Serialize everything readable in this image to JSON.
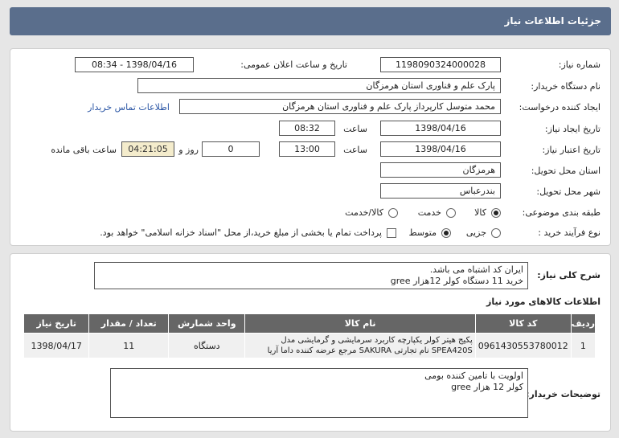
{
  "header": {
    "title": "جزئیات اطلاعات نیاز"
  },
  "form": {
    "need_number_label": "شماره نیاز:",
    "need_number": "1198090324000028",
    "announce_label": "تاریخ و ساعت اعلان عمومی:",
    "announce_value": "1398/04/16 - 08:34",
    "buyer_org_label": "نام دستگاه خریدار:",
    "buyer_org": "پارک علم و فناوری استان هرمزگان",
    "requester_label": "ایجاد کننده درخواست:",
    "requester": "محمد متوسل کارپرداز پارک علم و فناوری استان هرمزگان",
    "contact_link": "اطلاعات تماس خریدار",
    "created_label": "تاریخ ایجاد نیاز:",
    "created_date": "1398/04/16",
    "time_label": "ساعت",
    "created_time": "08:32",
    "validity_label": "تاریخ اعتبار نیاز:",
    "validity_date": "1398/04/16",
    "validity_time": "13:00",
    "days_value": "0",
    "days_label": "روز و",
    "remaining_time": "04:21:05",
    "remaining_label": "ساعت باقی مانده",
    "province_label": "استان محل تحویل:",
    "province": "هرمزگان",
    "city_label": "شهر محل تحویل:",
    "city": "بندرعباس",
    "category_label": "طبقه بندی موضوعی:",
    "category_options": [
      "کالا",
      "خدمت",
      "کالا/خدمت"
    ],
    "category_selected": 0,
    "process_label": "نوع فرآیند خرید :",
    "process_options": [
      "جزیی",
      "متوسط"
    ],
    "process_selected": 1,
    "payment_note": "پرداخت تمام یا بخشی از مبلغ خرید،از محل \"اسناد خزانه اسلامی\" خواهد بود."
  },
  "summary": {
    "label": "شرح کلی نیاز:",
    "line1": "ایران کد اشتباه می باشد.",
    "line2": "خرید 11 دستگاه کولر 12هزار gree"
  },
  "goods": {
    "title": "اطلاعات کالاهای مورد نیاز",
    "columns": [
      "ردیف",
      "کد کالا",
      "نام کالا",
      "واحد شمارش",
      "تعداد / مقدار",
      "تاریخ نیاز"
    ],
    "rows": [
      {
        "index": "1",
        "code": "0961430553780012",
        "name": "پکیج هیتر کولر یکپارچه کاربرد سرمایشی و گرمایشی مدل SPEA420S نام تجارتی SAKURA مرجع عرضه کننده داما آریا",
        "unit": "دستگاه",
        "qty": "11",
        "date": "1398/04/17"
      }
    ]
  },
  "buyer_notes": {
    "label": "توضیحات خریدار:",
    "line1": "اولویت با تامین کننده بومی",
    "line2": "کولر 12 هزار gree"
  }
}
